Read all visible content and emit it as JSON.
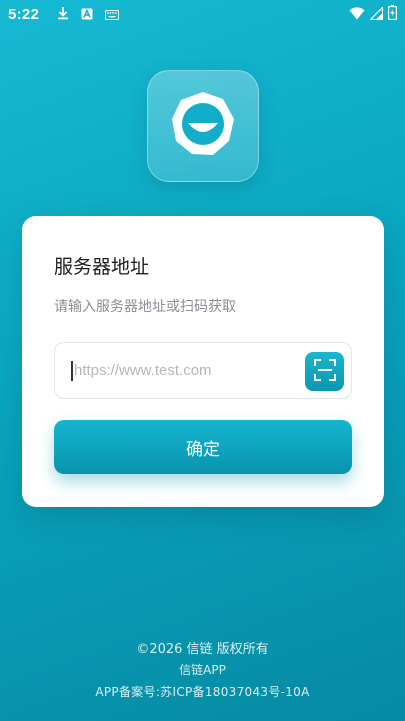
{
  "status_bar": {
    "time": "5:22",
    "left_icons": [
      "download-icon",
      "keyboard-a-icon",
      "keyboard-icon"
    ],
    "right_icons": [
      "wifi-icon",
      "signal-icon",
      "battery-icon"
    ]
  },
  "logo": {
    "icon": "smiley-logo-icon"
  },
  "card": {
    "title": "服务器地址",
    "subtitle": "请输入服务器地址或扫码获取",
    "url_input": {
      "placeholder": "https://www.test.com",
      "value": ""
    },
    "scan_icon": "scan-icon",
    "confirm_label": "确定"
  },
  "footer": {
    "copyright": "©2026 信链 版权所有",
    "app_name": "信链APP",
    "icp": "APP备案号:苏ICP备18037043号-10A"
  },
  "colors": {
    "background_top": "#16b9d3",
    "background_bottom": "#068aa3",
    "accent": "#0aa6c0",
    "card": "#ffffff"
  }
}
